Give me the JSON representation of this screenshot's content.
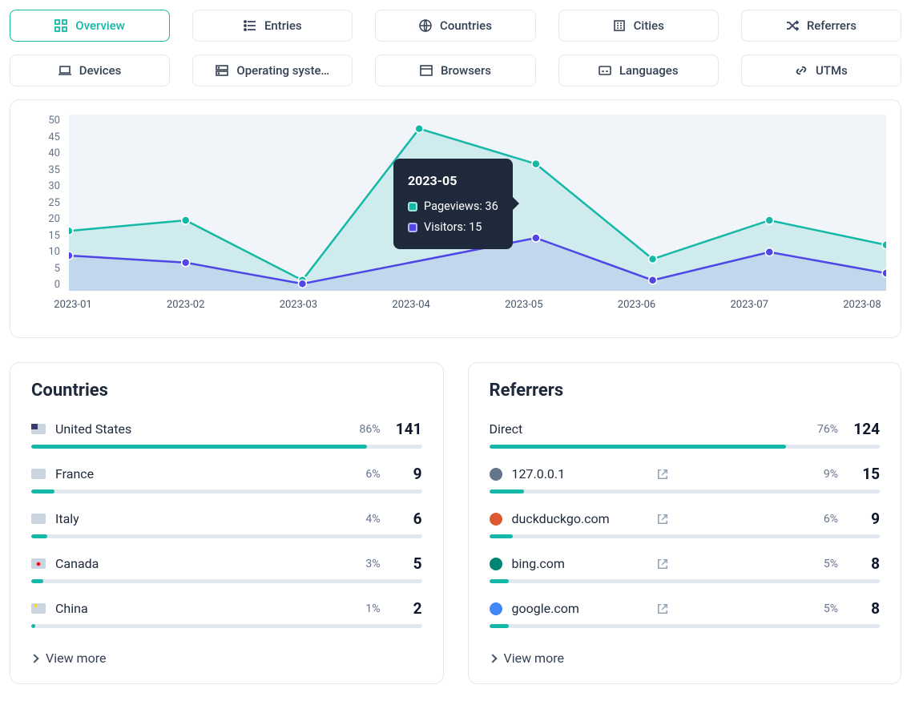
{
  "tabs": {
    "row1": [
      {
        "label": "Overview",
        "active": true,
        "icon": "grid-icon"
      },
      {
        "label": "Entries",
        "active": false,
        "icon": "list-icon"
      },
      {
        "label": "Countries",
        "active": false,
        "icon": "globe-icon"
      },
      {
        "label": "Cities",
        "active": false,
        "icon": "building-icon"
      },
      {
        "label": "Referrers",
        "active": false,
        "icon": "shuffle-icon"
      }
    ],
    "row2": [
      {
        "label": "Devices",
        "active": false,
        "icon": "laptop-icon"
      },
      {
        "label": "Operating syste…",
        "active": false,
        "icon": "server-icon"
      },
      {
        "label": "Browsers",
        "active": false,
        "icon": "window-icon"
      },
      {
        "label": "Languages",
        "active": false,
        "icon": "caption-icon"
      },
      {
        "label": "UTMs",
        "active": false,
        "icon": "link-icon"
      }
    ]
  },
  "chart_data": {
    "type": "line",
    "xlabel": "",
    "ylabel": "",
    "ylim": [
      0,
      50
    ],
    "yticks": [
      50,
      45,
      40,
      35,
      30,
      25,
      20,
      15,
      10,
      5,
      0
    ],
    "categories": [
      "2023-01",
      "2023-02",
      "2023-03",
      "2023-04",
      "2023-05",
      "2023-06",
      "2023-07",
      "2023-08"
    ],
    "series": [
      {
        "name": "Pageviews",
        "color": "#14b8a6",
        "values": [
          17,
          20,
          3,
          46,
          36,
          9,
          20,
          13
        ]
      },
      {
        "name": "Visitors",
        "color": "#4f46e5",
        "values": [
          10,
          8,
          2,
          null,
          15,
          3,
          11,
          5
        ]
      }
    ],
    "tooltip": {
      "label": "2023-05",
      "items": [
        {
          "name": "Pageviews",
          "value": 36,
          "color": "#14b8a6"
        },
        {
          "name": "Visitors",
          "value": 15,
          "color": "#4f46e5"
        }
      ]
    }
  },
  "panels": {
    "countries": {
      "title": "Countries",
      "rows": [
        {
          "label": "United States",
          "pct": "86%",
          "num": "141",
          "bar": 86,
          "flag": "flag-us"
        },
        {
          "label": "France",
          "pct": "6%",
          "num": "9",
          "bar": 6,
          "flag": "flag-fr"
        },
        {
          "label": "Italy",
          "pct": "4%",
          "num": "6",
          "bar": 4,
          "flag": "flag-it"
        },
        {
          "label": "Canada",
          "pct": "3%",
          "num": "5",
          "bar": 3,
          "flag": "flag-ca"
        },
        {
          "label": "China",
          "pct": "1%",
          "num": "2",
          "bar": 1,
          "flag": "flag-cn"
        }
      ],
      "more": "View more"
    },
    "referrers": {
      "title": "Referrers",
      "rows": [
        {
          "label": "Direct",
          "pct": "76%",
          "num": "124",
          "bar": 76,
          "favicon": "",
          "ext": false
        },
        {
          "label": "127.0.0.1",
          "pct": "9%",
          "num": "15",
          "bar": 9,
          "favicon": "#64748b",
          "ext": true
        },
        {
          "label": "duckduckgo.com",
          "pct": "6%",
          "num": "9",
          "bar": 6,
          "favicon": "#de5833",
          "ext": true
        },
        {
          "label": "bing.com",
          "pct": "5%",
          "num": "8",
          "bar": 5,
          "favicon": "#008373",
          "ext": true
        },
        {
          "label": "google.com",
          "pct": "5%",
          "num": "8",
          "bar": 5,
          "favicon": "#4285f4",
          "ext": true
        }
      ],
      "more": "View more"
    }
  }
}
